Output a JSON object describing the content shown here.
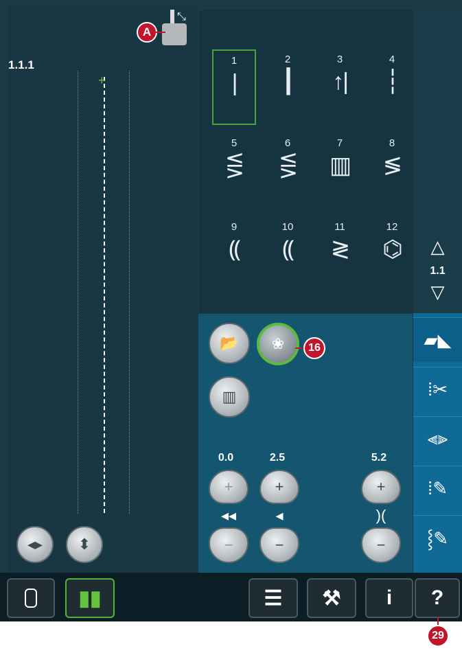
{
  "preview": {
    "stitch_id": "1.1.1",
    "callout_label": "A"
  },
  "stitch_grid": {
    "stitches": [
      {
        "number": "1",
        "glyph": "|"
      },
      {
        "number": "2",
        "glyph": "┃"
      },
      {
        "number": "3",
        "glyph": "↑|"
      },
      {
        "number": "4",
        "glyph": "┆"
      },
      {
        "number": "5",
        "glyph": "⋚"
      },
      {
        "number": "6",
        "glyph": "⋚"
      },
      {
        "number": "7",
        "glyph": "▥"
      },
      {
        "number": "8",
        "glyph": "≶"
      },
      {
        "number": "9",
        "glyph": "⸨"
      },
      {
        "number": "10",
        "glyph": "⸨"
      },
      {
        "number": "11",
        "glyph": "≷"
      },
      {
        "number": "12",
        "glyph": "⌬"
      }
    ],
    "selected": "1",
    "page": "1.1"
  },
  "controls": {
    "callout_16": "16",
    "stitch_width": "0.0",
    "stitch_length": "2.5",
    "stitch_density": "5.2",
    "plus": "+",
    "minus": "−"
  },
  "side_menu": {
    "icons": [
      "stitch-menu-icon",
      "cut-thread-icon",
      "balance-icon",
      "sequence-icon",
      "stitch-creator-icon"
    ]
  },
  "bottom_bar": {
    "callout_29": "29",
    "help_label": "?",
    "info_label": "i"
  },
  "colors": {
    "background": "#1b3a46",
    "selection_green": "#4aa43a",
    "callout_red": "#c0152b",
    "side_blue": "#0f6a95"
  }
}
